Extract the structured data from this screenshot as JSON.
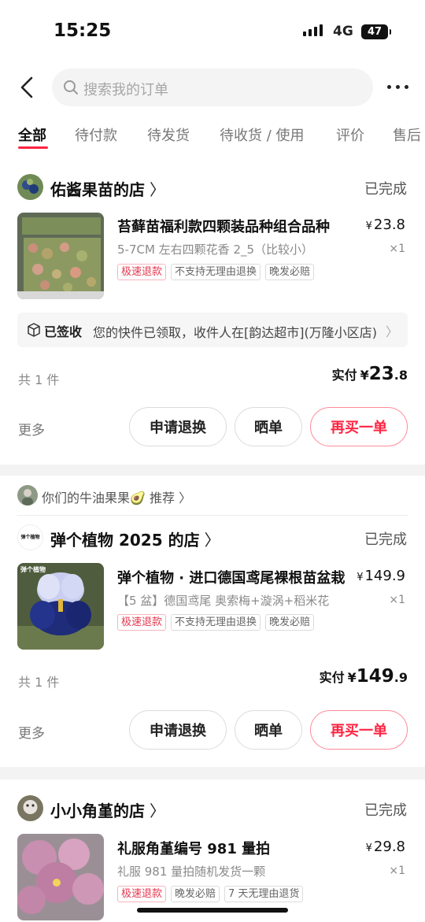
{
  "status_bar": {
    "time": "15:25",
    "network": "4G",
    "battery": "47"
  },
  "search": {
    "placeholder": "搜索我的订单"
  },
  "tabs": [
    {
      "label": "全部"
    },
    {
      "label": "待付款"
    },
    {
      "label": "待发货"
    },
    {
      "label": "待收货 / 使用"
    },
    {
      "label": "评价"
    },
    {
      "label": "售后"
    }
  ],
  "orders": [
    {
      "shop_name": "佑酱果苗的店",
      "status": "已完成",
      "product": {
        "title": "苔藓苗福利款四颗装品种组合品种",
        "spec": "5-7CM 左右四颗花香 2_5（比较小）",
        "currency": "¥",
        "price": "23.8",
        "qty": "×1",
        "tags": [
          "极速退款",
          "不支持无理由退换",
          "晚发必赔"
        ]
      },
      "logistics": {
        "status": "已签收",
        "text": "您的快件已领取，收件人在[韵达超市](万隆小区店)"
      },
      "count": "共 1 件",
      "paid_label": "实付",
      "paid_currency": "¥",
      "paid_int": "23",
      "paid_dec": ".8",
      "more_label": "更多",
      "buttons": [
        "申请退换",
        "晒单",
        "再买一单"
      ]
    },
    {
      "recommend_text": "你们的牛油果果🥑 推荐 〉",
      "shop_name": "弹个植物 2025 的店",
      "shop_avatar_text": "弹个植物",
      "status": "已完成",
      "product": {
        "title": "弹个植物 · 进口德国鸢尾裸根苗盆栽",
        "spec": "【5 盆】德国鸢尾 奥索梅+漩涡+稻米花",
        "thumb_label": "弹个植物",
        "currency": "¥",
        "price": "149.9",
        "qty": "×1",
        "tags": [
          "极速退款",
          "不支持无理由退换",
          "晚发必赔"
        ]
      },
      "count": "共 1 件",
      "paid_label": "实付",
      "paid_currency": "¥",
      "paid_int": "149",
      "paid_dec": ".9",
      "more_label": "更多",
      "buttons": [
        "申请退换",
        "晒单",
        "再买一单"
      ]
    },
    {
      "shop_name": "小小角堇的店",
      "status": "已完成",
      "product": {
        "title": "礼服角堇编号 981 量拍",
        "spec": "礼服 981 量拍随机发货一颗",
        "currency": "¥",
        "price": "29.8",
        "qty": "×1",
        "tags": [
          "极速退款",
          "晚发必赔",
          "7 天无理由退货"
        ]
      }
    }
  ],
  "colors": {
    "accent": "#ff2442",
    "background": "#f3f3f3"
  }
}
